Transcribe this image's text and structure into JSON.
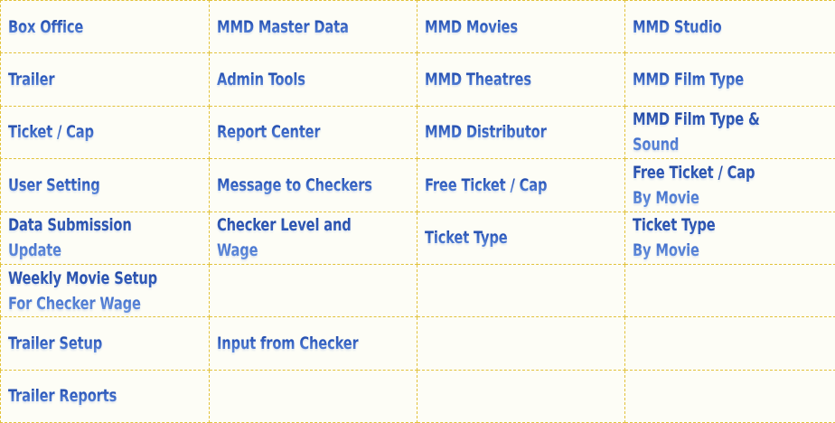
{
  "menu": {
    "rows": [
      [
        "Box Office",
        "MMD Master Data",
        "MMD Movies",
        "MMD Studio"
      ],
      [
        "Trailer",
        "Admin Tools",
        "MMD Theatres",
        "MMD Film Type"
      ],
      [
        "Ticket / Cap",
        "Report Center",
        "MMD Distributor",
        "MMD Film Type & Sound"
      ],
      [
        "User Setting",
        "Message to Checkers",
        "Free Ticket / Cap",
        "Free Ticket / Cap\nBy Movie"
      ],
      [
        "Data Submission Update",
        "Checker Level and Wage",
        "Ticket Type",
        "Ticket Type\nBy Movie"
      ],
      [
        "Weekly Movie Setup\nFor Checker Wage",
        "",
        "",
        ""
      ],
      [
        "Trailer Setup",
        "Input from Checker",
        "",
        ""
      ],
      [
        "Trailer Reports",
        "",
        "",
        ""
      ]
    ]
  },
  "colors": {
    "link_top": "#1b3f99",
    "link_bottom": "#6f9be6",
    "grid_line": "#e2c23a",
    "background": "#fdfdf6"
  }
}
